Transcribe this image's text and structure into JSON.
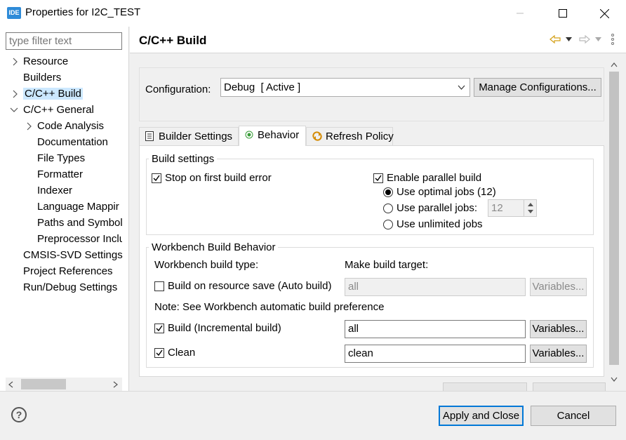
{
  "window": {
    "app_icon_text": "IDE",
    "title": "Properties for I2C_TEST"
  },
  "sidebar": {
    "filter_placeholder": "type filter text",
    "items": [
      {
        "label": "Resource"
      },
      {
        "label": "Builders"
      },
      {
        "label": "C/C++ Build"
      },
      {
        "label": "C/C++ General"
      },
      {
        "label": "Code Analysis"
      },
      {
        "label": "Documentation"
      },
      {
        "label": "File Types"
      },
      {
        "label": "Formatter"
      },
      {
        "label": "Indexer"
      },
      {
        "label": "Language Mappir"
      },
      {
        "label": "Paths and Symbol"
      },
      {
        "label": "Preprocessor Inclu"
      },
      {
        "label": "CMSIS-SVD Settings"
      },
      {
        "label": "Project References"
      },
      {
        "label": "Run/Debug Settings"
      }
    ],
    "selected": "C/C++ Build"
  },
  "page": {
    "title": "C/C++ Build",
    "config_label": "Configuration:",
    "config_value": "Debug  [ Active ]",
    "manage_button": "Manage Configurations...",
    "tabs": [
      {
        "label": "Builder Settings",
        "icon": "list-icon"
      },
      {
        "label": "Behavior",
        "icon": "radio-dot-icon"
      },
      {
        "label": "Refresh Policy",
        "icon": "refresh-icon"
      }
    ],
    "active_tab": "Behavior"
  },
  "build_settings": {
    "legend": "Build settings",
    "stop_on_error": {
      "label": "Stop on first build error",
      "checked": true
    },
    "parallel": {
      "label": "Enable parallel build",
      "checked": true
    },
    "optimal_jobs": {
      "label": "Use optimal jobs (12)",
      "selected": true
    },
    "parallel_jobs": {
      "label": "Use parallel jobs:",
      "value": "12",
      "selected": false
    },
    "unlimited_jobs": {
      "label": "Use unlimited jobs",
      "selected": false
    }
  },
  "workbench": {
    "legend": "Workbench Build Behavior",
    "type_label": "Workbench build type:",
    "target_label": "Make build target:",
    "auto_build": {
      "label": "Build on resource save (Auto build)",
      "checked": false,
      "target": "all",
      "button": "Variables..."
    },
    "note": "Note: See Workbench automatic build preference",
    "incremental": {
      "label": "Build (Incremental build)",
      "checked": true,
      "target": "all",
      "button": "Variables..."
    },
    "clean": {
      "label": "Clean",
      "checked": true,
      "target": "clean",
      "button": "Variables..."
    }
  },
  "footer": {
    "help": "?",
    "apply": "Apply and Close",
    "cancel": "Cancel"
  },
  "colors": {
    "accent": "#0078d7",
    "selection": "#cce8ff",
    "app_icon": "#2e8bd8"
  }
}
